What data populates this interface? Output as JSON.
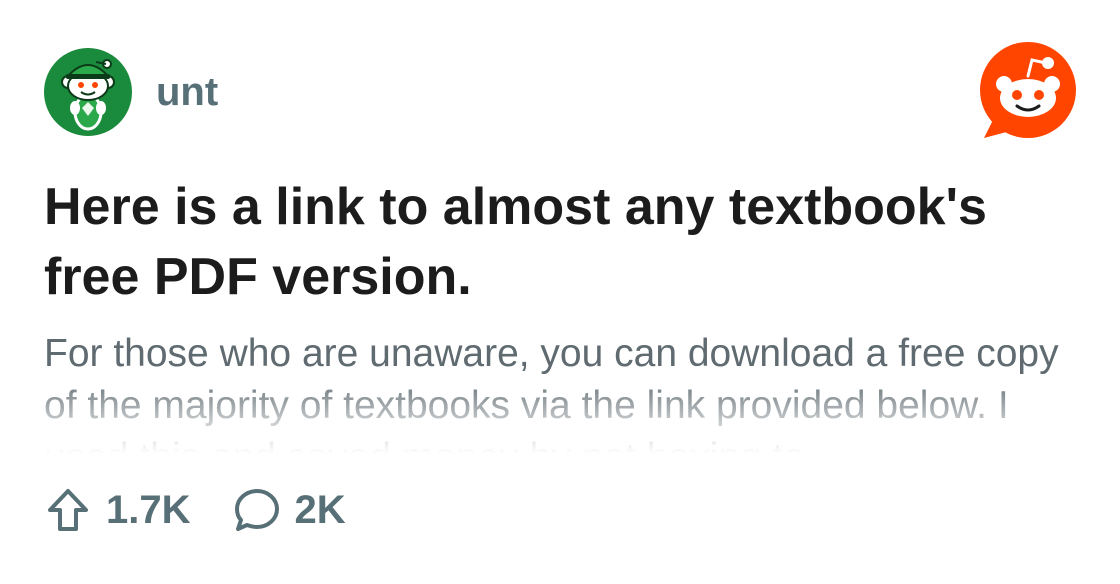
{
  "post": {
    "subreddit": "unt",
    "title": "Here is a link to almost any textbook's free PDF version.",
    "body": "For those who are unaware, you can download a free copy of the majority of textbooks via the link provided below. I used this and saved money by not having to",
    "upvotes": "1.7K",
    "comments": "2K"
  },
  "icons": {
    "avatar": "subreddit-avatar-icon",
    "logo": "reddit-logo-icon",
    "upvote": "upvote-arrow-icon",
    "comment": "comment-bubble-icon"
  },
  "colors": {
    "brand": "#ff4500",
    "avatar_bg": "#1a8a3c",
    "title": "#1c1c1c",
    "muted": "#576f76"
  }
}
